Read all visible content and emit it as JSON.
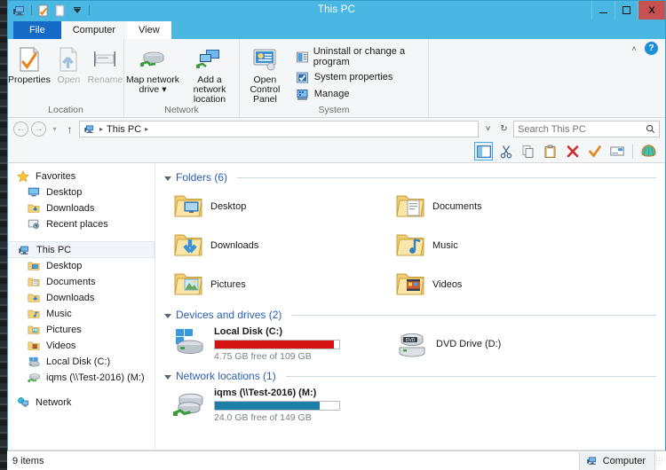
{
  "window": {
    "title": "This PC",
    "minimize_label": "–",
    "maximize_label": "",
    "close_label": "X"
  },
  "quick_access": {
    "items": [
      {
        "name": "this-pc-icon",
        "label": ""
      },
      {
        "name": "properties-icon",
        "label": ""
      },
      {
        "name": "new-folder-icon",
        "label": ""
      },
      {
        "name": "customize-dropdown-icon",
        "label": "▾"
      }
    ]
  },
  "tabs": [
    {
      "id": "file",
      "label": "File"
    },
    {
      "id": "computer",
      "label": "Computer"
    },
    {
      "id": "view",
      "label": "View"
    }
  ],
  "ribbon": {
    "collapse_label": "˄",
    "help_label": "?",
    "groups": [
      {
        "label": "Location",
        "buttons": [
          {
            "label": "Properties",
            "icon": "properties-icon",
            "disabled": false
          },
          {
            "label": "Open",
            "icon": "open-icon",
            "disabled": true
          },
          {
            "label": "Rename",
            "icon": "rename-icon",
            "disabled": true
          }
        ]
      },
      {
        "label": "Network",
        "buttons": [
          {
            "label": "Map network drive ▾",
            "icon": "map-network-drive-icon",
            "disabled": false
          },
          {
            "label": "Add a network location",
            "icon": "add-network-location-icon",
            "disabled": false
          }
        ]
      },
      {
        "label": "System",
        "buttons": [
          {
            "label": "Open Control Panel",
            "icon": "control-panel-icon",
            "disabled": false
          }
        ],
        "list_items": [
          {
            "label": "Uninstall or change a program",
            "icon": "uninstall-program-icon"
          },
          {
            "label": "System properties",
            "icon": "system-properties-icon"
          },
          {
            "label": "Manage",
            "icon": "manage-icon"
          }
        ]
      }
    ]
  },
  "address_bar": {
    "back_label": "←",
    "forward_label": "→",
    "history_label": "▾",
    "up_label": "↑",
    "crumbs": [
      "This PC"
    ],
    "crumb_separator": "▸",
    "dropdown_label": "˅",
    "refresh_label": "↻"
  },
  "search": {
    "placeholder": "Search This PC",
    "value": "",
    "icon": "search-icon"
  },
  "command_toolbar": {
    "buttons": [
      {
        "name": "navigation-pane-toggle",
        "selected": true
      },
      {
        "name": "cut-icon",
        "selected": false
      },
      {
        "name": "copy-icon",
        "selected": false
      },
      {
        "name": "paste-icon",
        "selected": false
      },
      {
        "name": "delete-icon",
        "selected": false
      },
      {
        "name": "confirm-check-icon",
        "selected": false
      },
      {
        "name": "rename-box-icon",
        "selected": false
      },
      {
        "name": "shell-icon",
        "selected": false
      }
    ]
  },
  "nav_pane": {
    "sections": [
      {
        "header": {
          "label": "Favorites",
          "icon": "star-icon"
        },
        "items": [
          {
            "label": "Desktop",
            "icon": "desktop-icon"
          },
          {
            "label": "Downloads",
            "icon": "downloads-folder-icon"
          },
          {
            "label": "Recent places",
            "icon": "recent-places-icon"
          }
        ]
      },
      {
        "header": {
          "label": "This PC",
          "icon": "this-pc-icon",
          "selected": true
        },
        "items": [
          {
            "label": "Desktop",
            "icon": "desktop-folder-icon"
          },
          {
            "label": "Documents",
            "icon": "documents-folder-icon"
          },
          {
            "label": "Downloads",
            "icon": "downloads-folder-icon"
          },
          {
            "label": "Music",
            "icon": "music-folder-icon"
          },
          {
            "label": "Pictures",
            "icon": "pictures-folder-icon"
          },
          {
            "label": "Videos",
            "icon": "videos-folder-icon"
          },
          {
            "label": "Local Disk (C:)",
            "icon": "local-disk-icon"
          },
          {
            "label": "iqms (\\\\Test-2016) (M:)",
            "icon": "network-drive-icon"
          }
        ]
      },
      {
        "header": {
          "label": "Network",
          "icon": "network-icon"
        },
        "items": []
      }
    ]
  },
  "content": {
    "folders_group": {
      "title": "Folders (6)",
      "items": [
        {
          "label": "Desktop",
          "icon": "desktop-folder-icon"
        },
        {
          "label": "Documents",
          "icon": "documents-folder-icon"
        },
        {
          "label": "Downloads",
          "icon": "downloads-folder-icon"
        },
        {
          "label": "Music",
          "icon": "music-folder-icon"
        },
        {
          "label": "Pictures",
          "icon": "pictures-folder-icon"
        },
        {
          "label": "Videos",
          "icon": "videos-folder-icon"
        }
      ]
    },
    "devices_group": {
      "title": "Devices and drives (2)",
      "items": [
        {
          "label": "Local Disk (C:)",
          "icon": "local-disk-icon",
          "free_text": "4.75 GB free of 109 GB",
          "free_gb": 4.75,
          "total_gb": 109,
          "used_percent": 96,
          "bar_color": "#d41313",
          "has_bar": true
        },
        {
          "label": "DVD Drive (D:)",
          "icon": "dvd-drive-icon",
          "free_text": "",
          "has_bar": false
        }
      ]
    },
    "network_group": {
      "title": "Network locations (1)",
      "items": [
        {
          "label": "iqms (\\\\Test-2016) (M:)",
          "icon": "network-drive-icon",
          "free_text": "24.0 GB free of 149 GB",
          "free_gb": 24.0,
          "total_gb": 149,
          "used_percent": 84,
          "bar_color": "#1c7fa8",
          "has_bar": true
        }
      ]
    }
  },
  "status_bar": {
    "item_count": "9 items",
    "view_buttons": [
      {
        "name": "details-view-button"
      },
      {
        "name": "large-icons-view-button"
      }
    ]
  },
  "taskbar": {
    "item_count": "9 items",
    "app_label": "Computer",
    "app_icon": "this-pc-icon"
  }
}
